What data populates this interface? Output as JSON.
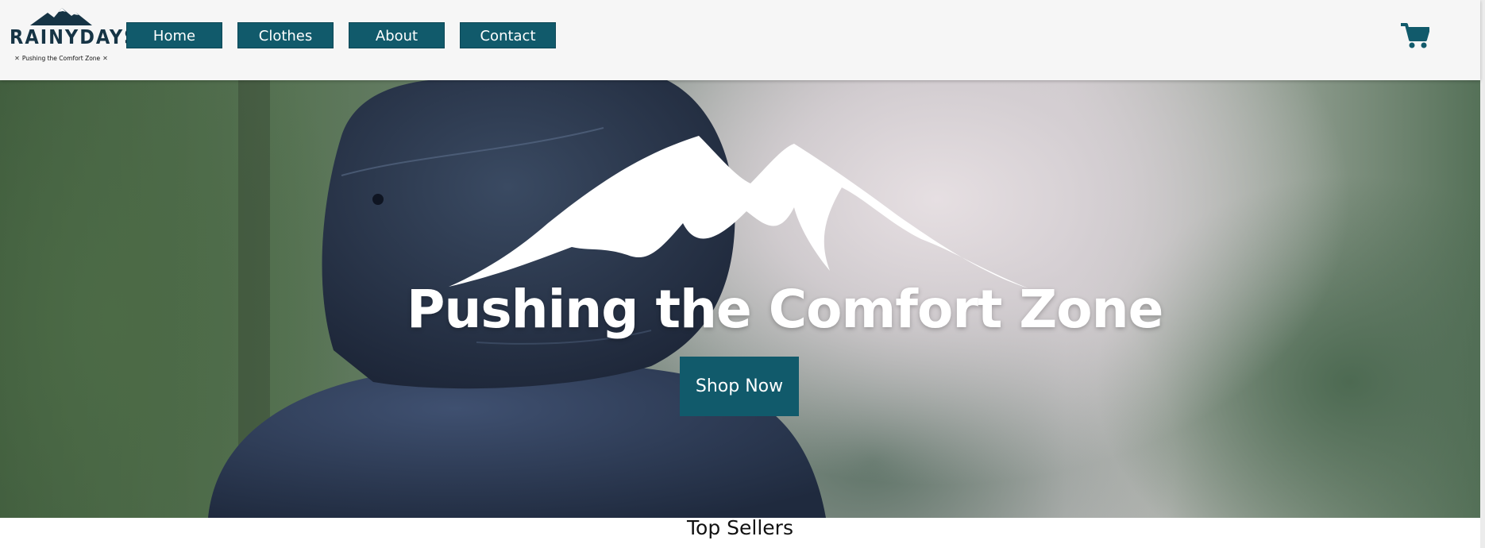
{
  "brand": {
    "name": "RAINYDAYS",
    "tagline": "Pushing the Comfort Zone",
    "primary_color": "#115a6b",
    "logo_icon": "mountain-icon"
  },
  "nav": {
    "items": [
      {
        "label": "Home"
      },
      {
        "label": "Clothes"
      },
      {
        "label": "About"
      },
      {
        "label": "Contact"
      }
    ],
    "cart_icon": "shopping-cart-icon"
  },
  "hero": {
    "title": "Pushing the Comfort Zone",
    "cta_label": "Shop Now",
    "graphic_icon": "mountain-icon"
  },
  "sections": {
    "top_sellers_title": "Top Sellers"
  }
}
